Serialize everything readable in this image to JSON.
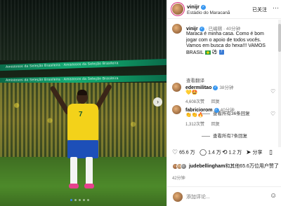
{
  "post": {
    "username": "vinijr",
    "location": "Estádio do Maracanã",
    "follow_label": "已关注",
    "more_label": "···",
    "next_label": "›",
    "led_text_1": "Amistosos da Seleção Brasileira · Amistosos da Seleção Brasileira",
    "led_text_2": "Amistosos da Seleção Brasileira · Amistosos da Seleção Brasileira",
    "jersey_number": "7"
  },
  "caption": {
    "username": "vinijr",
    "edited": "· 已编辑 · 40分钟",
    "text": "Maraca é minha casa. Como é bom jogar com o apoio de todos vocês. Vamos em busca do hexa!!! VAMOS BRASIL",
    "translate_label": "查看翻译"
  },
  "comments": [
    {
      "username": "edermilitao",
      "time": "38分钟",
      "body": "💛🤩",
      "likes": "4,608次赞",
      "reply": "回复",
      "view_replies": "查看所有36条回复"
    },
    {
      "username": "fabriciorom",
      "time": "40分钟",
      "body": "👏👏🔥",
      "likes": "1,312次赞",
      "reply": "回复",
      "view_replies": "查看所有7条回复"
    }
  ],
  "actions": {
    "like_count": "65.6 万",
    "comment_count": "1.4 万",
    "share_count": "1.2 万",
    "share_label": "分享"
  },
  "likes": {
    "prefix_user": "judebellingham",
    "suffix": "和其他65.6万位用户赞了"
  },
  "post_time": "42分钟",
  "composer": {
    "placeholder": "添加评论..."
  },
  "icons": {
    "verified": "verified-badge-icon",
    "heart": "heart-icon",
    "comment": "comment-icon",
    "repost": "repost-icon",
    "share": "send-icon",
    "bookmark": "bookmark-icon",
    "emoji": "emoji-icon"
  },
  "colors": {
    "verified_blue": "#3897f0",
    "jersey_yellow": "#f3d21a",
    "shorts_blue": "#1d4fb8"
  }
}
